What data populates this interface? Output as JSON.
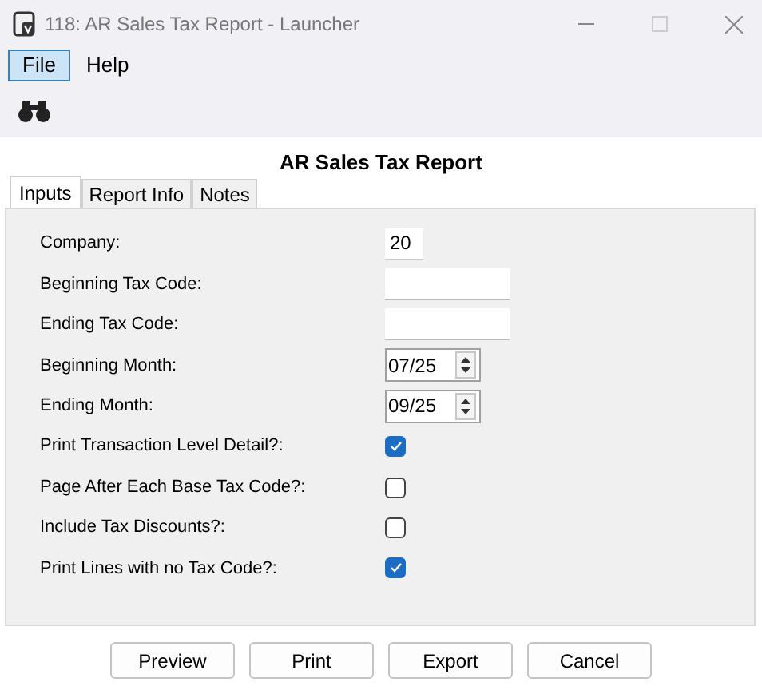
{
  "window": {
    "title": "118: AR Sales Tax Report - Launcher"
  },
  "menu": [
    {
      "label": "File",
      "selected": true
    },
    {
      "label": "Help",
      "selected": false
    }
  ],
  "heading": "AR Sales Tax Report",
  "tabs": [
    {
      "label": "Inputs",
      "selected": true
    },
    {
      "label": "Report Info",
      "selected": false
    },
    {
      "label": "Notes",
      "selected": false
    }
  ],
  "fields": [
    {
      "kind": "short",
      "label": "Company:",
      "value": "20"
    },
    {
      "kind": "text",
      "label": "Beginning Tax Code:"
    },
    {
      "kind": "text",
      "label": "Ending Tax Code:"
    },
    {
      "kind": "spin",
      "label": "Beginning Month:",
      "value": "07/25"
    },
    {
      "kind": "spin",
      "label": "Ending Month:",
      "value": "09/25"
    },
    {
      "kind": "check",
      "label": "Print Transaction Level Detail?:",
      "checked": true
    },
    {
      "kind": "check",
      "label": "Page After Each Base Tax Code?:",
      "checked": false
    },
    {
      "kind": "check",
      "label": "Include Tax Discounts?:",
      "checked": false
    },
    {
      "kind": "check",
      "label": "Print Lines with no Tax Code?:",
      "checked": true
    }
  ],
  "buttons": [
    "Preview",
    "Print",
    "Export",
    "Cancel"
  ]
}
